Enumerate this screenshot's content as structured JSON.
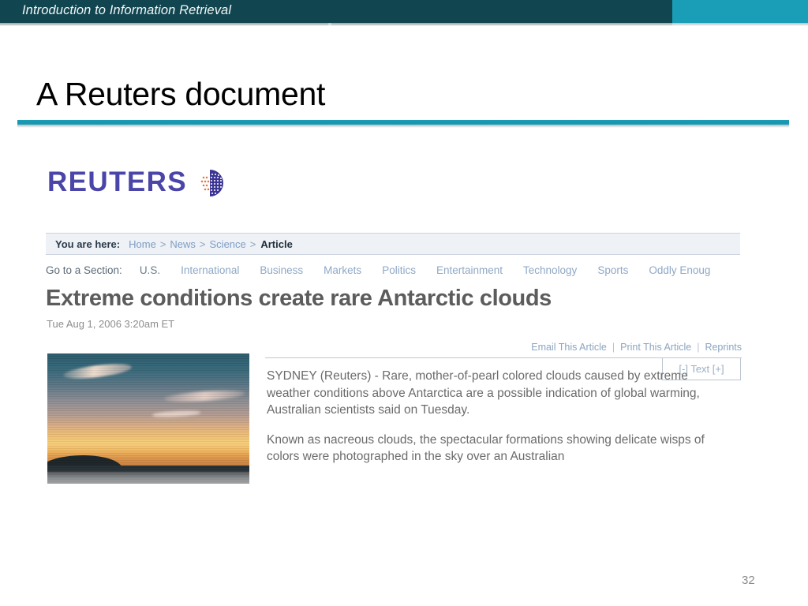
{
  "slide": {
    "header_title": "Introduction to Information Retrieval",
    "title": "A Reuters document",
    "page_number": "32",
    "accent_dark": "#114650",
    "accent_light": "#1a9eb7"
  },
  "document": {
    "brand": {
      "wordmark": "REUTERS",
      "wordmark_color": "#4a45a8",
      "globe_icon": "reuters-globe-icon"
    },
    "breadcrumb": {
      "label": "You are here:",
      "links": [
        "Home",
        "News",
        "Science"
      ],
      "separator": ">",
      "current": "Article"
    },
    "sections": {
      "label": "Go to a Section:",
      "items": [
        "U.S.",
        "International",
        "Business",
        "Markets",
        "Politics",
        "Entertainment",
        "Technology",
        "Sports",
        "Oddly Enoug"
      ]
    },
    "article": {
      "headline": "Extreme conditions create rare Antarctic clouds",
      "timestamp": "Tue Aug 1, 2006 3:20am ET",
      "tools": [
        "Email This Article",
        "Print This Article",
        "Reprints"
      ],
      "tools_separator": "|",
      "text_size_control": "[-] Text [+]",
      "photo_alt": "nacreous-clouds-sunset-photo",
      "paragraphs": [
        "SYDNEY (Reuters) - Rare, mother-of-pearl colored clouds caused by extreme weather conditions above Antarctica are a possible indication of global warming, Australian scientists said on Tuesday.",
        "Known as nacreous clouds, the spectacular formations showing delicate wisps of colors were photographed in the sky over an Australian"
      ]
    }
  }
}
